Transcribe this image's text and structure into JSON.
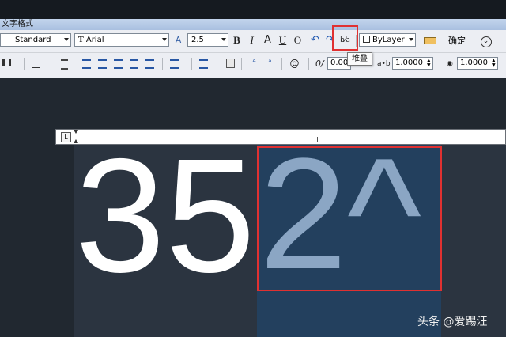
{
  "panel": {
    "title": "文字格式",
    "style_select": "Standard",
    "font_select": "Arial",
    "font_prefix": "T",
    "height_icon": "A",
    "height_value": "2.5",
    "bold": "B",
    "italic": "I",
    "strike": "A",
    "underline": "U",
    "overline": "Ō",
    "undo": "↶",
    "redo": "↷",
    "stack_icon": "b⁄a",
    "color_select": "ByLayer",
    "ok_label": "确定",
    "options_icon": "⌄",
    "tooltip": "堆叠"
  },
  "row2": {
    "oblique_label": "0/",
    "oblique_value": "0.000",
    "tracking_label": "a•b",
    "tracking_value": "1.0000",
    "width_label": "◉",
    "width_value": "1.0000"
  },
  "editor": {
    "plain_text": "35",
    "selected_text": "2^"
  },
  "watermark": "头条 @爱踢汪",
  "colors": {
    "selection": "#23405e",
    "highlight_box": "#e03131",
    "selected_glyph": "#8ba6c4",
    "plain_glyph": "#ffffff",
    "canvas": "#2b3440"
  }
}
